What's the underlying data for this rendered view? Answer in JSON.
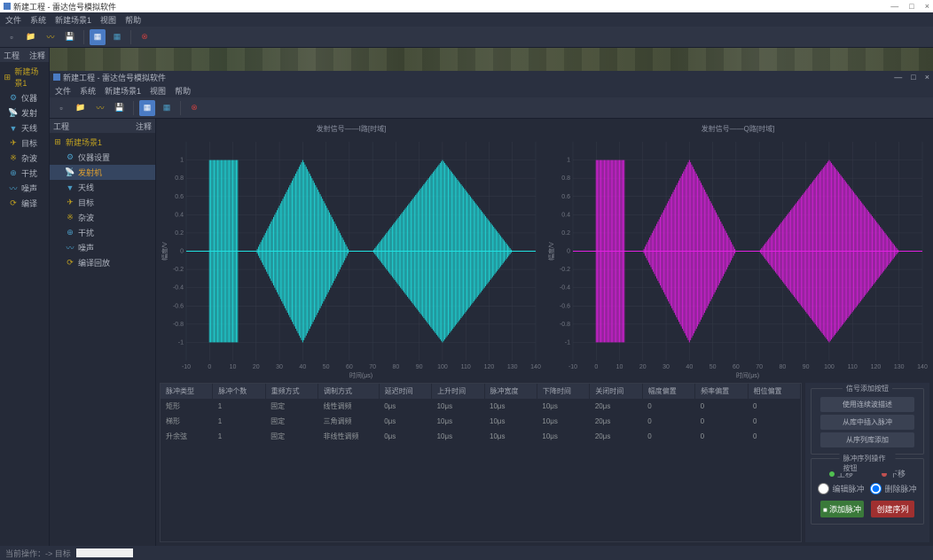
{
  "outer": {
    "title": "新建工程 - 雷达信号模拟软件",
    "min": "—",
    "max": "□",
    "close": "×"
  },
  "menu": [
    "文件",
    "系统",
    "新建场景1",
    "视图",
    "帮助"
  ],
  "outer_panel": {
    "head1": "工程",
    "head2": "注释"
  },
  "outer_tree": {
    "root_icon": "⊞",
    "root": "新建场景1",
    "items": [
      {
        "icon": "⚙",
        "label": "仪器",
        "color": "#4a9bc4"
      },
      {
        "icon": "📡",
        "label": "发射",
        "color": "#c0a020"
      },
      {
        "icon": "▼",
        "label": "天线",
        "color": "#4a9bc4"
      },
      {
        "icon": "✈",
        "label": "目标",
        "color": "#c0a020"
      },
      {
        "icon": "※",
        "label": "杂波",
        "color": "#c0a020"
      },
      {
        "icon": "⊕",
        "label": "干扰",
        "color": "#4a9bc4"
      },
      {
        "icon": "〰",
        "label": "噪声",
        "color": "#4a9bc4"
      },
      {
        "icon": "⟳",
        "label": "编译",
        "color": "#c0a020"
      }
    ]
  },
  "inner": {
    "title": "新建工程 - 雷达信号模拟软件"
  },
  "inner_tree": {
    "root_icon": "⊞",
    "root": "新建场景1",
    "items": [
      {
        "icon": "⚙",
        "label": "仪器设置",
        "color": "#4a9bc4"
      },
      {
        "icon": "📡",
        "label": "发射机",
        "color": "#c0a020",
        "selected": true
      },
      {
        "icon": "▼",
        "label": "天线",
        "color": "#4a9bc4"
      },
      {
        "icon": "✈",
        "label": "目标",
        "color": "#c0a020"
      },
      {
        "icon": "※",
        "label": "杂波",
        "color": "#c0a020"
      },
      {
        "icon": "⊕",
        "label": "干扰",
        "color": "#4a9bc4"
      },
      {
        "icon": "〰",
        "label": "噪声",
        "color": "#4a9bc4"
      },
      {
        "icon": "⟳",
        "label": "编译回放",
        "color": "#c0a020"
      }
    ]
  },
  "chart_data": [
    {
      "type": "line",
      "title": "发射信号——I路[时域]",
      "xlabel": "时间(μs)",
      "ylabel": "幅度/V",
      "xlim": [
        -10,
        140
      ],
      "ylim": [
        -1.2,
        1.2
      ],
      "xticks": [
        -10,
        0,
        10,
        20,
        30,
        40,
        50,
        60,
        70,
        80,
        90,
        100,
        110,
        120,
        130,
        140
      ],
      "yticks": [
        -1.0,
        -0.8,
        -0.6,
        -0.4,
        -0.2,
        0,
        0.2,
        0.4,
        0.6,
        0.8,
        1.0
      ],
      "color": "#20e0e0",
      "pulses": [
        {
          "start": 0,
          "end": 12,
          "shape": "rect"
        },
        {
          "start": 20,
          "end": 60,
          "shape": "diamond"
        },
        {
          "start": 70,
          "end": 130,
          "shape": "diamond"
        }
      ]
    },
    {
      "type": "line",
      "title": "发射信号——Q路[时域]",
      "xlabel": "时间(μs)",
      "ylabel": "幅度/V",
      "xlim": [
        -10,
        140
      ],
      "ylim": [
        -1.2,
        1.2
      ],
      "xticks": [
        -10,
        0,
        10,
        20,
        30,
        40,
        50,
        60,
        70,
        80,
        90,
        100,
        110,
        120,
        130,
        140
      ],
      "yticks": [
        -1.0,
        -0.8,
        -0.6,
        -0.4,
        -0.2,
        0,
        0.2,
        0.4,
        0.6,
        0.8,
        1.0
      ],
      "color": "#e020e0",
      "pulses": [
        {
          "start": 0,
          "end": 12,
          "shape": "rect"
        },
        {
          "start": 20,
          "end": 60,
          "shape": "diamond"
        },
        {
          "start": 70,
          "end": 130,
          "shape": "diamond"
        }
      ]
    }
  ],
  "table": {
    "headers": [
      "脉冲类型",
      "脉冲个数",
      "重频方式",
      "调制方式",
      "延迟时间",
      "上升时间",
      "脉冲宽度",
      "下降时间",
      "关闭时间",
      "幅度偏置",
      "频率偏置",
      "相位偏置"
    ],
    "rows": [
      [
        "矩形",
        "1",
        "固定",
        "线性调频",
        "0μs",
        "10μs",
        "10μs",
        "10μs",
        "20μs",
        "0",
        "0",
        "0"
      ],
      [
        "梯形",
        "1",
        "固定",
        "三角调频",
        "0μs",
        "10μs",
        "10μs",
        "10μs",
        "20μs",
        "0",
        "0",
        "0"
      ],
      [
        "升余弦",
        "1",
        "固定",
        "非线性调频",
        "0μs",
        "10μs",
        "10μs",
        "10μs",
        "20μs",
        "0",
        "0",
        "0"
      ]
    ]
  },
  "side": {
    "group1_title": "信号添加按钮",
    "g1_btn1": "使用连续波描述",
    "g1_btn2": "从库中插入脉冲",
    "g1_btn3": "从序列库添加",
    "group2_title": "脉冲序列操作按钮",
    "up": "上移",
    "down": "下移",
    "edit": "编辑脉冲",
    "del": "删除脉冲",
    "add": "添加脉冲",
    "create": "创建序列"
  },
  "status": {
    "label": "当前操作：-> 目标"
  }
}
